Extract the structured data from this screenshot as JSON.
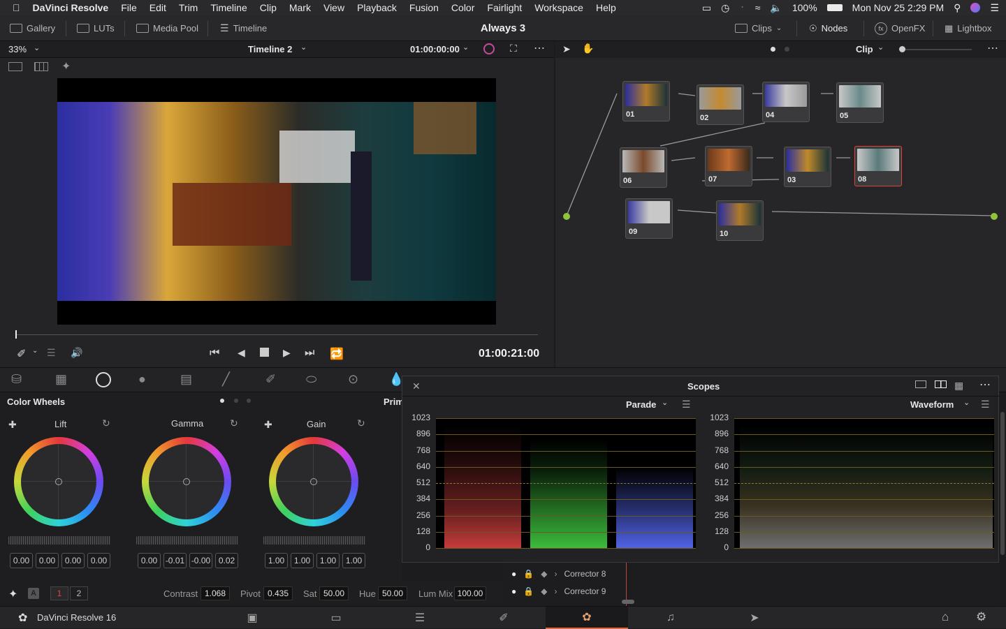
{
  "menubar": {
    "app": "DaVinci Resolve",
    "items": [
      "File",
      "Edit",
      "Trim",
      "Timeline",
      "Clip",
      "Mark",
      "View",
      "Playback",
      "Fusion",
      "Color",
      "Fairlight",
      "Workspace",
      "Help"
    ],
    "battery": "100%",
    "clock": "Mon Nov 25  2:29 PM"
  },
  "toolbar": {
    "gallery": "Gallery",
    "luts": "LUTs",
    "media_pool": "Media Pool",
    "timeline": "Timeline",
    "project_title": "Always 3",
    "clips": "Clips",
    "nodes": "Nodes",
    "openfx": "OpenFX",
    "lightbox": "Lightbox"
  },
  "viewer": {
    "zoom": "33%",
    "timeline_name": "Timeline 2",
    "timecode_in": "01:00:00:00",
    "timecode_current": "01:00:21:00"
  },
  "nodes_panel": {
    "mode": "Clip",
    "nodes": [
      "01",
      "02",
      "04",
      "05",
      "06",
      "07",
      "03",
      "08",
      "09",
      "10"
    ]
  },
  "color_wheels": {
    "title": "Color Wheels",
    "next_panel": "Prim",
    "wheels": [
      {
        "label": "Lift",
        "values": [
          "0.00",
          "0.00",
          "0.00",
          "0.00"
        ]
      },
      {
        "label": "Gamma",
        "values": [
          "0.00",
          "-0.01",
          "-0.00",
          "0.02"
        ]
      },
      {
        "label": "Gain",
        "values": [
          "1.00",
          "1.00",
          "1.00",
          "1.00"
        ]
      }
    ]
  },
  "primary_params": {
    "page1": "1",
    "page2": "2",
    "contrast_label": "Contrast",
    "contrast": "1.068",
    "pivot_label": "Pivot",
    "pivot": "0.435",
    "sat_label": "Sat",
    "sat": "50.00",
    "hue_label": "Hue",
    "hue": "50.00",
    "lummix_label": "Lum Mix",
    "lummix": "100.00"
  },
  "scopes": {
    "title": "Scopes",
    "left_mode": "Parade",
    "right_mode": "Waveform",
    "ticks": [
      "1023",
      "896",
      "768",
      "640",
      "512",
      "384",
      "256",
      "128",
      "0"
    ]
  },
  "correctors": [
    "Corrector 8",
    "Corrector 9"
  ],
  "bottom": {
    "app_name": "DaVinci Resolve 16",
    "accent": "#e06a3a"
  }
}
